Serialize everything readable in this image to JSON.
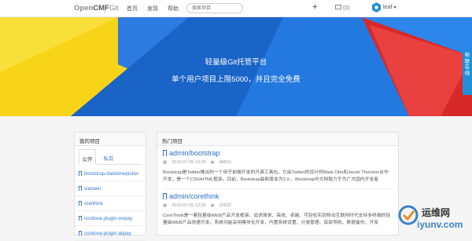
{
  "brand": {
    "name_part1": "Open",
    "name_part2": "CMF",
    "git": "Git"
  },
  "nav": {
    "items": [
      "首页",
      "发现",
      "帮助"
    ]
  },
  "search": {
    "placeholder": "搜索项目"
  },
  "header": {
    "add_label": "+",
    "messages": "(0)",
    "user": "leaf"
  },
  "hero": {
    "title": "轻量级Git托管平台",
    "subtitle": "单个用户项目上限5000，并且完全免费"
  },
  "feedback": {
    "label": "帮 联 在 线"
  },
  "my_projects": {
    "title": "我的项目",
    "tabs": [
      "公开",
      "私有"
    ],
    "items": [
      "bootstrap-datetimepicker",
      "xiaowei",
      "onethink",
      "cordova-plugin-wxpay",
      "cordova-plugin-alipay"
    ]
  },
  "hot_projects": {
    "title": "热门项目",
    "repos": [
      {
        "name": "admin/bootstrap",
        "date": "2016-07-05 13:30",
        "views": "48819",
        "description": "Bootstrap是Twitter推出的一个用于前端开发的开源工具包。它由Twitter的设计师Mark Otto和Jacob Thornton合作开发，是一个CSS/HTML框架。目前，Bootstrap最新版本为3.0 。Bootstrap中文网致力于为广大国内开发者"
      },
      {
        "name": "admin/corethink",
        "date": "2016-07-05 13:30",
        "views": "10532",
        "description": "CoreThink是一套轻量级WEB产品开发框架，追求简单、高效、卓越。可轻松实现移动互联网时代支持多终端的轻量级WEB产品快速开发。系统功能采用模块化开发，内置系统设置、分类管理、底部导航、数据备份、开发"
      }
    ]
  },
  "watermark": {
    "line1": "运维网",
    "line2": "iyunv.com"
  },
  "colors": {
    "accent": "#3a7bd5",
    "feedback": "#1e8fd8",
    "hero_blue": "#1f6fd6",
    "hero_red": "#e32d2d",
    "hero_yellow": "#f7d417"
  }
}
